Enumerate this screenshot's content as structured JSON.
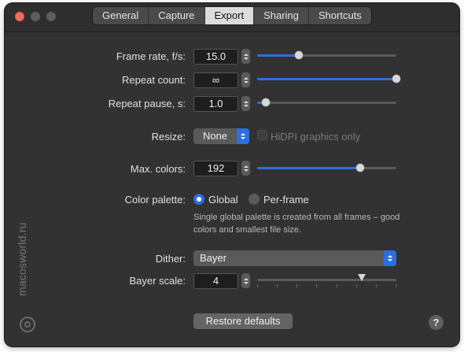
{
  "tabs": [
    {
      "label": "General"
    },
    {
      "label": "Capture"
    },
    {
      "label": "Export",
      "active": true
    },
    {
      "label": "Sharing"
    },
    {
      "label": "Shortcuts"
    }
  ],
  "frame_rate": {
    "label": "Frame rate, f/s:",
    "value": "15.0",
    "slider": 0.3
  },
  "repeat_count": {
    "label": "Repeat count:",
    "value": "∞",
    "slider": 1.0
  },
  "repeat_pause": {
    "label": "Repeat pause, s:",
    "value": "1.0",
    "slider": 0.06
  },
  "resize": {
    "label": "Resize:",
    "value": "None",
    "hidpi_label": "HiDPI graphics only",
    "hidpi_checked": false
  },
  "max_colors": {
    "label": "Max. colors:",
    "value": "192",
    "slider": 0.74
  },
  "color_palette": {
    "label": "Color palette:",
    "options": [
      {
        "label": "Global",
        "selected": true
      },
      {
        "label": "Per-frame",
        "selected": false
      }
    ],
    "description_line1": "Single global palette is created from all frames – good",
    "description_line2": "colors and smallest file size."
  },
  "dither": {
    "label": "Dither:",
    "value": "Bayer"
  },
  "bayer_scale": {
    "label": "Bayer scale:",
    "value": "4",
    "slider": 0.75,
    "ticks": 8
  },
  "restore_label": "Restore defaults",
  "help_label": "?",
  "watermark": "macosworld.ru",
  "colors": {
    "accent": "#2b6fe0",
    "window": "#323232"
  }
}
